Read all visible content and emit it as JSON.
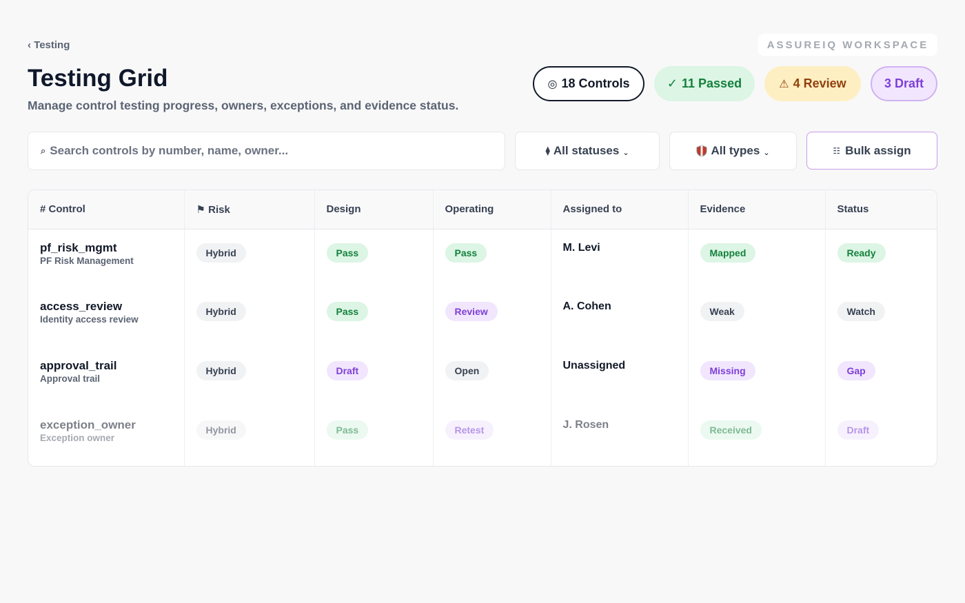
{
  "breadcrumb": "‹ Testing",
  "workspace": "ASSUREIQ WORKSPACE",
  "page": {
    "title": "Testing Grid",
    "subtitle": "Manage control testing progress, owners, exceptions, and evidence status."
  },
  "stats": {
    "controls": "18 Controls",
    "passed": "11 Passed",
    "review": "4 Review",
    "draft": "3 Draft"
  },
  "icons": {
    "controls": "target-icon",
    "passed": "check-icon",
    "review": "warning-icon",
    "search": "search-icon",
    "status_filter": "pin-icon",
    "type_filter": "shield-icon",
    "bulk": "list-icon"
  },
  "toolbar": {
    "search_placeholder": "Search controls by number, name, owner...",
    "status_filter": "All statuses",
    "type_filter": "All types",
    "bulk_assign": "Bulk assign"
  },
  "table": {
    "headers": [
      "# Control",
      "⚑ Risk",
      "Design",
      "Operating",
      "Assigned to",
      "Evidence",
      "Status"
    ],
    "rows": [
      {
        "name": "pf_risk_mgmt",
        "desc": "PF Risk Management",
        "risk": "Hybrid",
        "design": "Pass",
        "operating": "Pass",
        "assigned": "M. Levi",
        "evidence": "Mapped",
        "status": "Ready"
      },
      {
        "name": "access_review",
        "desc": "Identity access review",
        "risk": "Hybrid",
        "design": "Pass",
        "operating": "Review",
        "assigned": "A. Cohen",
        "evidence": "Weak",
        "status": "Watch"
      },
      {
        "name": "approval_trail",
        "desc": "Approval trail",
        "risk": "Hybrid",
        "design": "Draft",
        "operating": "Open",
        "assigned": "Unassigned",
        "evidence": "Missing",
        "status": "Gap"
      },
      {
        "name": "exception_owner",
        "desc": "Exception owner",
        "risk": "Hybrid",
        "design": "Pass",
        "operating": "Retest",
        "assigned": "J. Rosen",
        "evidence": "Received",
        "status": "Draft"
      }
    ]
  },
  "colors": {
    "pass": "#15803d",
    "review": "#7e3fd6",
    "warning": "#92400e",
    "neutral": "#374151"
  }
}
